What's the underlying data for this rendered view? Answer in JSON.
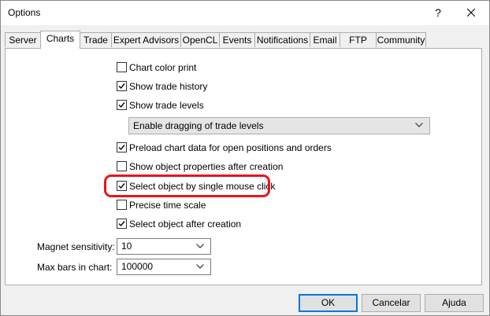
{
  "window": {
    "title": "Options",
    "help_glyph": "?"
  },
  "tabs": [
    "Server",
    "Charts",
    "Trade",
    "Expert Advisors",
    "OpenCL",
    "Events",
    "Notifications",
    "Email",
    "FTP",
    "Community"
  ],
  "active_tab": "Charts",
  "options": {
    "chart_color_print": {
      "label": "Chart color print",
      "checked": false
    },
    "show_trade_history": {
      "label": "Show trade history",
      "checked": true
    },
    "show_trade_levels": {
      "label": "Show trade levels",
      "checked": true
    },
    "trade_levels_mode": {
      "value": "Enable dragging of trade levels"
    },
    "preload_chart_data": {
      "label": "Preload chart data for open positions and orders",
      "checked": true
    },
    "show_object_properties": {
      "label": "Show object properties after creation",
      "checked": false
    },
    "select_single_click": {
      "label": "Select object by single mouse click",
      "checked": true
    },
    "precise_time_scale": {
      "label": "Precise time scale",
      "checked": false
    },
    "select_after_creation": {
      "label": "Select object after creation",
      "checked": true
    }
  },
  "fields": {
    "magnet_sensitivity": {
      "label": "Magnet sensitivity:",
      "value": "10"
    },
    "max_bars": {
      "label": "Max bars in chart:",
      "value": "100000"
    }
  },
  "buttons": {
    "ok": "OK",
    "cancel": "Cancelar",
    "help": "Ajuda"
  },
  "colors": {
    "highlight": "#e8141b",
    "default_button_border": "#0078d7"
  }
}
